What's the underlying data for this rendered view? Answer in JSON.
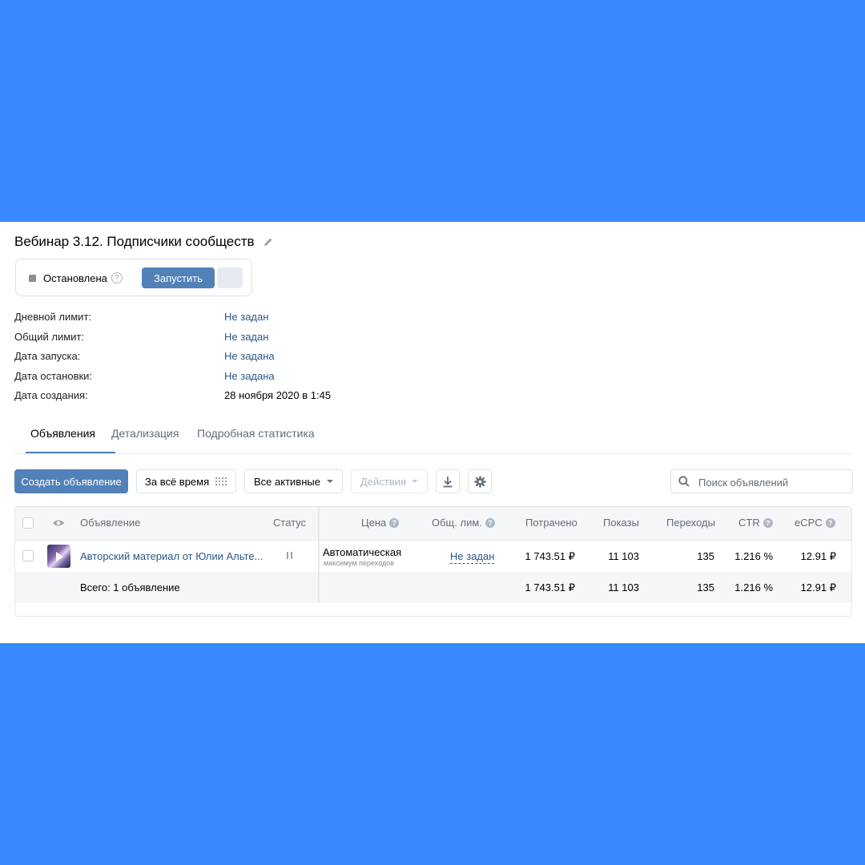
{
  "campaign": {
    "title": "Вебинар 3.12. Подписчики сообществ",
    "status_text": "Остановлена",
    "help_glyph": "?",
    "launch_label": "Запустить"
  },
  "properties": [
    {
      "label": "Дневной лимит:",
      "value": "Не задан"
    },
    {
      "label": "Общий лимит:",
      "value": "Не задан"
    },
    {
      "label": "Дата запуска:",
      "value": "Не задана"
    },
    {
      "label": "Дата остановки:",
      "value": "Не задана"
    },
    {
      "label": "Дата создания:",
      "value": "28 ноября 2020 в 1:45"
    }
  ],
  "tabs": [
    {
      "label": "Объявления",
      "active": true
    },
    {
      "label": "Детализация",
      "active": false
    },
    {
      "label": "Подробная статистика",
      "active": false
    }
  ],
  "toolbar": {
    "create_label": "Создать объявление",
    "period_label": "За всё время",
    "filter_label": "Все активные",
    "actions_label": "Действия",
    "search_placeholder": "Поиск объявлений"
  },
  "table": {
    "columns": {
      "ad": "Объявление",
      "status": "Статус",
      "price": "Цена",
      "limit": "Общ. лим.",
      "spent": "Потрачено",
      "impressions": "Показы",
      "clicks": "Переходы",
      "ctr": "CTR",
      "ecpc": "eCPC"
    },
    "rows": [
      {
        "ad_name": "Авторский материал от Юлии Альте...",
        "price_main": "Автоматическая",
        "price_sub": "максимум переходов",
        "limit": "Не задан",
        "spent": "1 743.51 ₽",
        "impressions": "11 103",
        "clicks": "135",
        "ctr": "1.216 %",
        "ecpc": "12.91 ₽"
      }
    ],
    "total": {
      "label": "Всего: 1 объявление",
      "spent": "1 743.51 ₽",
      "impressions": "11 103",
      "clicks": "135",
      "ctr": "1.216 %",
      "ecpc": "12.91 ₽"
    }
  },
  "icons": [
    "pencil-icon",
    "calendar-grid-icon",
    "chevron-down-icon",
    "download-icon",
    "gear-icon",
    "search-icon",
    "eye-icon",
    "pause-icon",
    "question-icon"
  ],
  "colors": {
    "background": "#3a88fe",
    "accent": "#5181b8",
    "link": "#2a5885"
  }
}
